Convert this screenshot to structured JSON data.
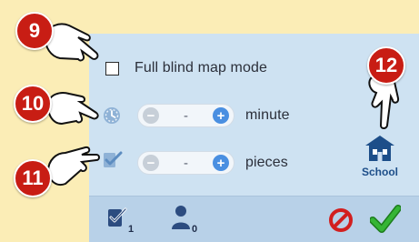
{
  "options": {
    "full_blind_map_label": "Full blind map mode",
    "time_stepper": {
      "minus": "−",
      "value": "-",
      "plus": "+",
      "unit": "minute"
    },
    "pieces_stepper": {
      "minus": "−",
      "value": "-",
      "plus": "+",
      "unit": "pieces"
    }
  },
  "school": {
    "label": "School"
  },
  "footer": {
    "checked_count": "1",
    "user_count": "0"
  },
  "callouts": [
    "9",
    "10",
    "11",
    "12"
  ],
  "colors": {
    "background": "#fbedb6",
    "panel": "#cee2f2",
    "footer": "#b8d1e8",
    "badge": "#c81d14",
    "plus_button": "#4a8fe1",
    "school_icon": "#1d4e89",
    "cancel": "#d21f1f",
    "confirm": "#2aa32a"
  },
  "icons": [
    "timer-icon",
    "checklist-icon",
    "school-icon",
    "checked-count-icon",
    "user-count-icon",
    "cancel-icon",
    "confirm-icon",
    "pointing-hand-icon"
  ]
}
